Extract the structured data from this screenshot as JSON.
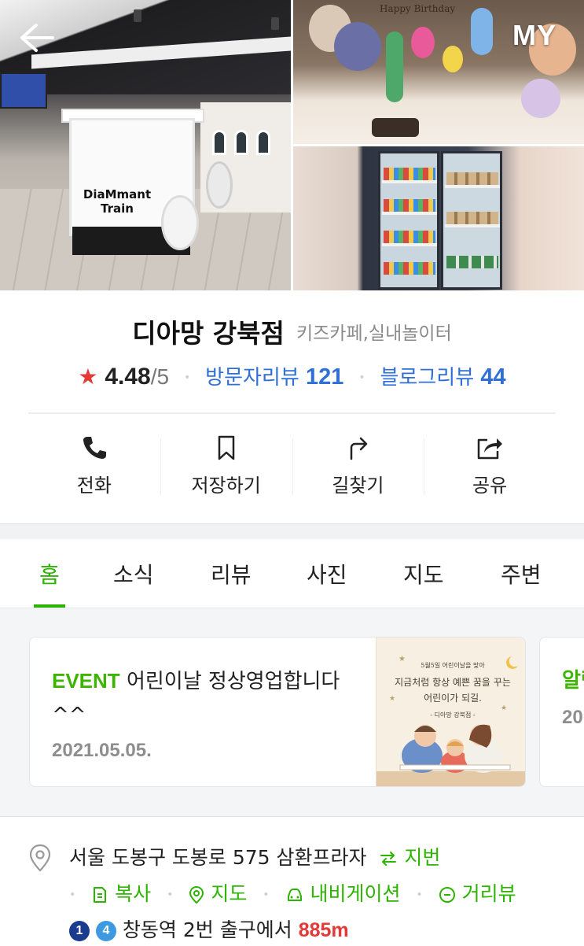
{
  "header": {
    "back_icon": "arrow-left-icon",
    "my_label": "MY"
  },
  "gallery": {
    "main_photo_sign": "DiaMmant Train",
    "party_banner": "Happy Birthday"
  },
  "place": {
    "name": "디아망 강북점",
    "category": "키즈카페,실내놀이터",
    "rating": "4.48",
    "rating_max": "/5",
    "visitor_review_label": "방문자리뷰",
    "visitor_review_count": "121",
    "blog_review_label": "블로그리뷰",
    "blog_review_count": "44"
  },
  "actions": [
    {
      "label": "전화",
      "icon": "phone-icon"
    },
    {
      "label": "저장하기",
      "icon": "bookmark-icon"
    },
    {
      "label": "길찾기",
      "icon": "directions-icon"
    },
    {
      "label": "공유",
      "icon": "share-icon"
    }
  ],
  "tabs": [
    {
      "label": "홈",
      "active": true
    },
    {
      "label": "소식",
      "active": false
    },
    {
      "label": "리뷰",
      "active": false
    },
    {
      "label": "사진",
      "active": false
    },
    {
      "label": "지도",
      "active": false
    },
    {
      "label": "주변",
      "active": false
    }
  ],
  "news": {
    "card1": {
      "tag": "EVENT",
      "title": "어린이날 정상영업합니다^^",
      "date": "2021.05.05.",
      "thumb_small": "5월5일 어린이날을 맞아",
      "thumb_big": "지금처럼 항상 예쁜 꿈을 꾸는 어린이가 되길.",
      "thumb_sig": "- 디아망 강북점 -"
    },
    "card2": {
      "tag": "알림",
      "date": "20"
    }
  },
  "address": {
    "text": "서울 도봉구 도봉로 575 삼환프라자",
    "lot_link": "지번",
    "links": [
      {
        "label": "복사",
        "icon": "copy-icon"
      },
      {
        "label": "지도",
        "icon": "map-pin-icon"
      },
      {
        "label": "내비게이션",
        "icon": "car-icon"
      },
      {
        "label": "거리뷰",
        "icon": "streetview-icon"
      }
    ],
    "line1": "1",
    "line4": "4",
    "station": "창동역",
    "exit_text": "2번 출구에서",
    "distance": "885m"
  },
  "colors": {
    "green": "#2db400",
    "blue": "#2f6fd6",
    "red": "#e53935",
    "line1": "#1a3c8f",
    "line4": "#3d9ae0"
  }
}
